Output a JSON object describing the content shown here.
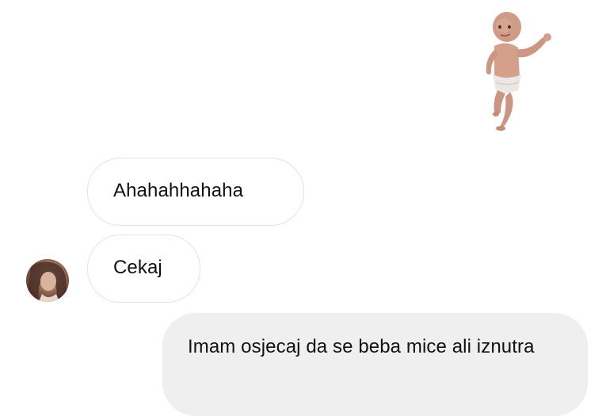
{
  "messages": [
    {
      "direction": "received",
      "text": "Ahahahhahaha"
    },
    {
      "direction": "received",
      "text": "Cekaj"
    },
    {
      "direction": "sent",
      "text": "Imam osjecaj da se beba mice ali iznutra"
    }
  ],
  "sticker": {
    "icon": "dancing-baby-sticker"
  },
  "avatar": {
    "icon": "contact-avatar"
  },
  "colors": {
    "background": "#ffffff",
    "received_bubble_border": "#e3e3e3",
    "sent_bubble_fill": "#efefef",
    "text": "#111111"
  }
}
